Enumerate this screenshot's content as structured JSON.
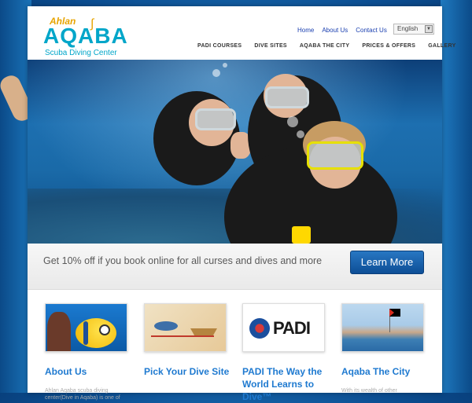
{
  "brand": {
    "prefix": "Ahlan",
    "name": "AQABA",
    "tagline": "Scuba Diving Center"
  },
  "top_nav": [
    {
      "label": "Home"
    },
    {
      "label": "About Us"
    },
    {
      "label": "Contact Us"
    }
  ],
  "language": {
    "selected": "English"
  },
  "main_nav": [
    {
      "label": "PADI COURSES"
    },
    {
      "label": "DIVE SITES"
    },
    {
      "label": "AQABA THE CITY"
    },
    {
      "label": "PRICES & OFFERS"
    },
    {
      "label": "GALLERY"
    }
  ],
  "promo": {
    "text": "Get 10% off if you book online for all curses and dives and more",
    "button": "Learn More"
  },
  "thumbnail_logo": "PADI",
  "cards": [
    {
      "title": "About Us",
      "desc": "Ahlan Aqaba scuba diving center(Dive in Aqaba) is one of"
    },
    {
      "title": "Pick Your Dive Site",
      "desc": ""
    },
    {
      "title": "PADI The Way the World Learns to Dive™",
      "desc": ""
    },
    {
      "title": "Aqaba The City",
      "desc": "With its wealth of other"
    }
  ],
  "colors": {
    "accent": "#1f7ad0",
    "brand_teal": "#00a6c9",
    "brand_gold": "#e7a400",
    "button": "#0d4e96"
  },
  "icons": {
    "language_dropdown": "chevron-down-icon"
  }
}
